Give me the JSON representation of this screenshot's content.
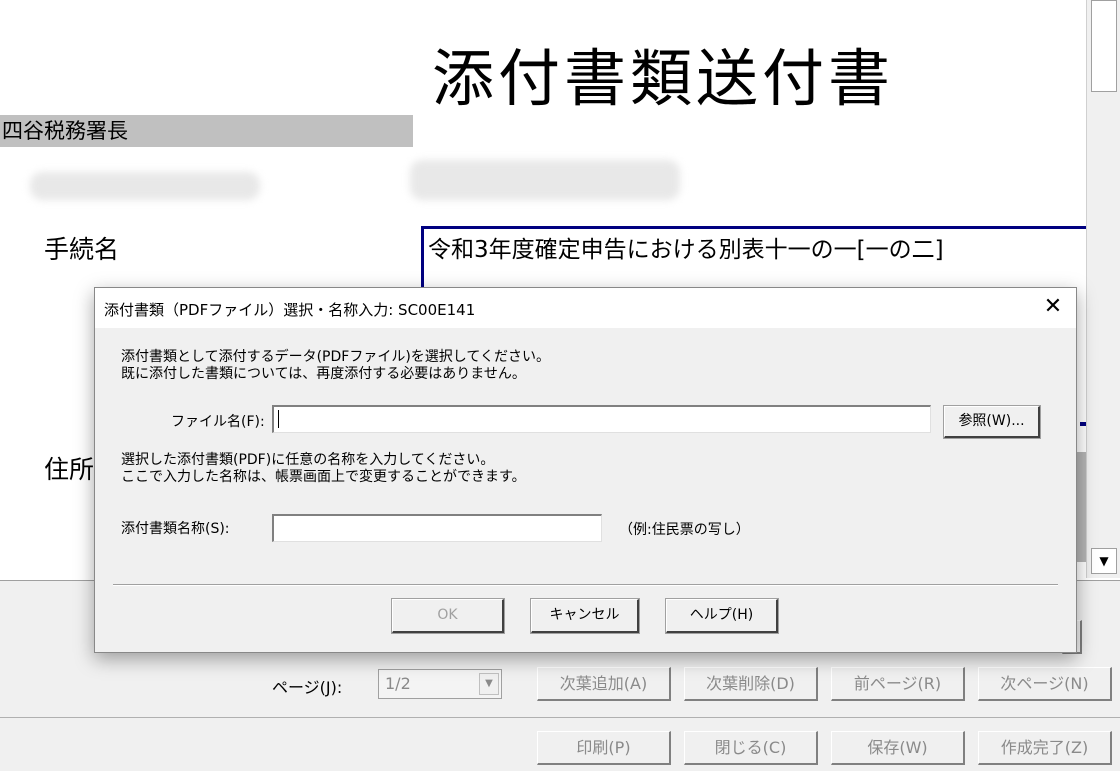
{
  "document": {
    "title": "添付書類送付書",
    "office": "四谷税務署長",
    "procedure_label": "手続名",
    "procedure_value": "令和3年度確定申告における別表十一の一[一の二]",
    "address_label": "住所"
  },
  "bottom_bar": {
    "page_label": "ページ(J):",
    "page_value": "1/2",
    "buttons_row1": [
      "次葉追加(A)",
      "次葉削除(D)",
      "前ページ(R)",
      "次ページ(N)"
    ],
    "buttons_row2": [
      "印刷(P)",
      "閉じる(C)",
      "保存(W)",
      "作成完了(Z)"
    ]
  },
  "dialog": {
    "title": "添付書類（PDFファイル）選択・名称入力: SC00E141",
    "close_symbol": "✕",
    "instruction1_line1": "添付書類として添付するデータ(PDFファイル)を選択してください。",
    "instruction1_line2": "既に添付した書類については、再度添付する必要はありません。",
    "file_label": "ファイル名(F):",
    "file_value": "",
    "browse_label": "参照(W)...",
    "instruction2_line1": "選択した添付書類(PDF)に任意の名称を入力してください。",
    "instruction2_line2": "ここで入力した名称は、帳票画面上で変更することができます。",
    "name_label": "添付書類名称(S):",
    "name_value": "",
    "name_example": "（例:住民票の写し）",
    "ok_label": "OK",
    "cancel_label": "キャンセル",
    "help_label": "ヘルプ(H)"
  },
  "icons": {
    "scroll_down": "▼",
    "dropdown": "▼"
  }
}
